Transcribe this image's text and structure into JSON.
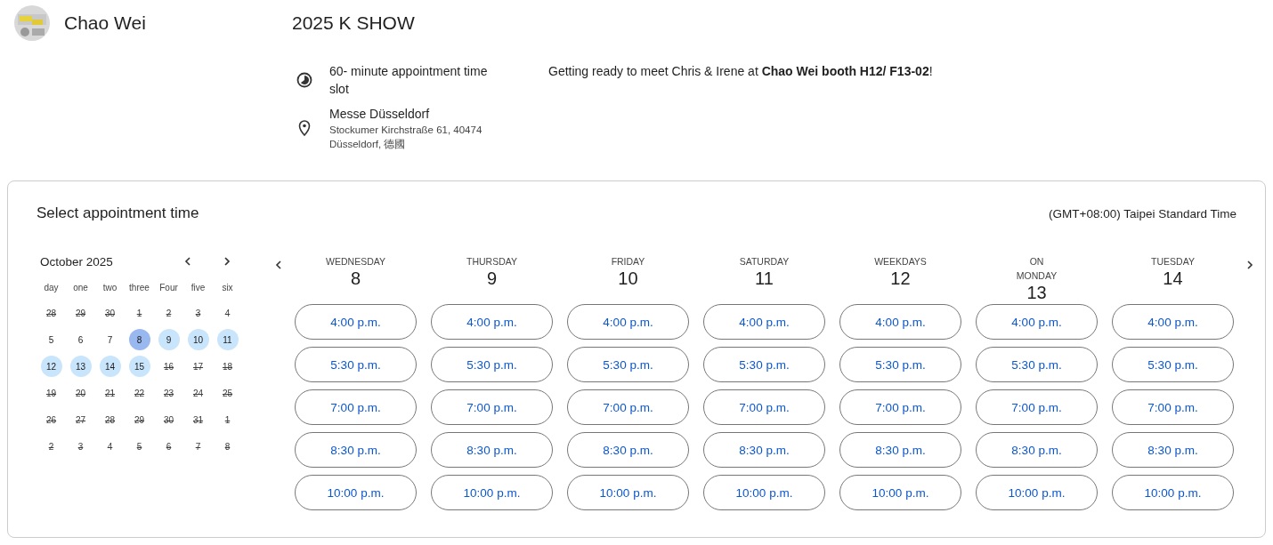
{
  "header": {
    "name": "Chao Wei",
    "event_title": "2025 K SHOW"
  },
  "details": {
    "duration": "60- minute appointment time slot",
    "location_name": "Messe Düsseldorf",
    "location_address": "Stockumer Kirchstraße 61, 40474 Düsseldorf, 德國",
    "description": "Getting ready to meet Chris & Irene at **Chao Wei booth H12/ F13-02**!"
  },
  "booking": {
    "title": "Select appointment time",
    "timezone": "(GMT+08:00) Taipei Standard Time",
    "calendar": {
      "month": "October 2025",
      "weekdays": [
        "day",
        "one",
        "two",
        "three",
        "Four",
        "five",
        "six"
      ],
      "days": [
        {
          "label": "28",
          "crossed": true,
          "available": false,
          "selected": false
        },
        {
          "label": "29",
          "crossed": true,
          "available": false,
          "selected": false
        },
        {
          "label": "30",
          "crossed": true,
          "available": false,
          "selected": false
        },
        {
          "label": "1",
          "crossed": true,
          "available": false,
          "selected": false
        },
        {
          "label": "2",
          "crossed": true,
          "available": false,
          "selected": false
        },
        {
          "label": "3",
          "crossed": true,
          "available": false,
          "selected": false
        },
        {
          "label": "4",
          "crossed": true,
          "available": false,
          "selected": false
        },
        {
          "label": "5",
          "crossed": false,
          "available": false,
          "selected": false
        },
        {
          "label": "6",
          "crossed": false,
          "available": false,
          "selected": false
        },
        {
          "label": "7",
          "crossed": false,
          "available": false,
          "selected": false
        },
        {
          "label": "8",
          "crossed": false,
          "available": true,
          "selected": true
        },
        {
          "label": "9",
          "crossed": false,
          "available": true,
          "selected": false
        },
        {
          "label": "10",
          "crossed": false,
          "available": true,
          "selected": false
        },
        {
          "label": "11",
          "crossed": false,
          "available": true,
          "selected": false
        },
        {
          "label": "12",
          "crossed": false,
          "available": true,
          "selected": false
        },
        {
          "label": "13",
          "crossed": false,
          "available": true,
          "selected": false
        },
        {
          "label": "14",
          "crossed": false,
          "available": true,
          "selected": false
        },
        {
          "label": "15",
          "crossed": false,
          "available": true,
          "selected": false
        },
        {
          "label": "16",
          "crossed": true,
          "available": false,
          "selected": false
        },
        {
          "label": "17",
          "crossed": true,
          "available": false,
          "selected": false
        },
        {
          "label": "18",
          "crossed": true,
          "available": false,
          "selected": false
        },
        {
          "label": "19",
          "crossed": true,
          "available": false,
          "selected": false
        },
        {
          "label": "20",
          "crossed": true,
          "available": false,
          "selected": false
        },
        {
          "label": "21",
          "crossed": true,
          "available": false,
          "selected": false
        },
        {
          "label": "22",
          "crossed": true,
          "available": false,
          "selected": false
        },
        {
          "label": "23",
          "crossed": true,
          "available": false,
          "selected": false
        },
        {
          "label": "24",
          "crossed": true,
          "available": false,
          "selected": false
        },
        {
          "label": "25",
          "crossed": true,
          "available": false,
          "selected": false
        },
        {
          "label": "26",
          "crossed": true,
          "available": false,
          "selected": false
        },
        {
          "label": "27",
          "crossed": true,
          "available": false,
          "selected": false
        },
        {
          "label": "28",
          "crossed": true,
          "available": false,
          "selected": false
        },
        {
          "label": "29",
          "crossed": true,
          "available": false,
          "selected": false
        },
        {
          "label": "30",
          "crossed": true,
          "available": false,
          "selected": false
        },
        {
          "label": "31",
          "crossed": true,
          "available": false,
          "selected": false
        },
        {
          "label": "1",
          "crossed": true,
          "available": false,
          "selected": false
        },
        {
          "label": "2",
          "crossed": true,
          "available": false,
          "selected": false
        },
        {
          "label": "3",
          "crossed": true,
          "available": false,
          "selected": false
        },
        {
          "label": "4",
          "crossed": true,
          "available": false,
          "selected": false
        },
        {
          "label": "5",
          "crossed": true,
          "available": false,
          "selected": false
        },
        {
          "label": "6",
          "crossed": true,
          "available": false,
          "selected": false
        },
        {
          "label": "7",
          "crossed": true,
          "available": false,
          "selected": false
        },
        {
          "label": "8",
          "crossed": true,
          "available": false,
          "selected": false
        }
      ]
    },
    "columns": [
      {
        "weekday": "WEDNESDAY",
        "date": "8",
        "slots": [
          "4:00 p.m.",
          "5:30 p.m.",
          "7:00 p.m.",
          "8:30 p.m.",
          "10:00 p.m."
        ]
      },
      {
        "weekday": "THURSDAY",
        "date": "9",
        "slots": [
          "4:00 p.m.",
          "5:30 p.m.",
          "7:00 p.m.",
          "8:30 p.m.",
          "10:00 p.m."
        ]
      },
      {
        "weekday": "FRIDAY",
        "date": "10",
        "slots": [
          "4:00 p.m.",
          "5:30 p.m.",
          "7:00 p.m.",
          "8:30 p.m.",
          "10:00 p.m."
        ]
      },
      {
        "weekday": "SATURDAY",
        "date": "11",
        "slots": [
          "4:00 p.m.",
          "5:30 p.m.",
          "7:00 p.m.",
          "8:30 p.m.",
          "10:00 p.m."
        ]
      },
      {
        "weekday": "WEEKDAYS",
        "date": "12",
        "slots": [
          "4:00 p.m.",
          "5:30 p.m.",
          "7:00 p.m.",
          "8:30 p.m.",
          "10:00 p.m."
        ]
      },
      {
        "weekday": "ON\nMONDAY",
        "date": "13",
        "slots": [
          "4:00 p.m.",
          "5:30 p.m.",
          "7:00 p.m.",
          "8:30 p.m.",
          "10:00 p.m."
        ]
      },
      {
        "weekday": "TUESDAY",
        "date": "14",
        "slots": [
          "4:00 p.m.",
          "5:30 p.m.",
          "7:00 p.m.",
          "8:30 p.m.",
          "10:00 p.m."
        ]
      }
    ]
  }
}
